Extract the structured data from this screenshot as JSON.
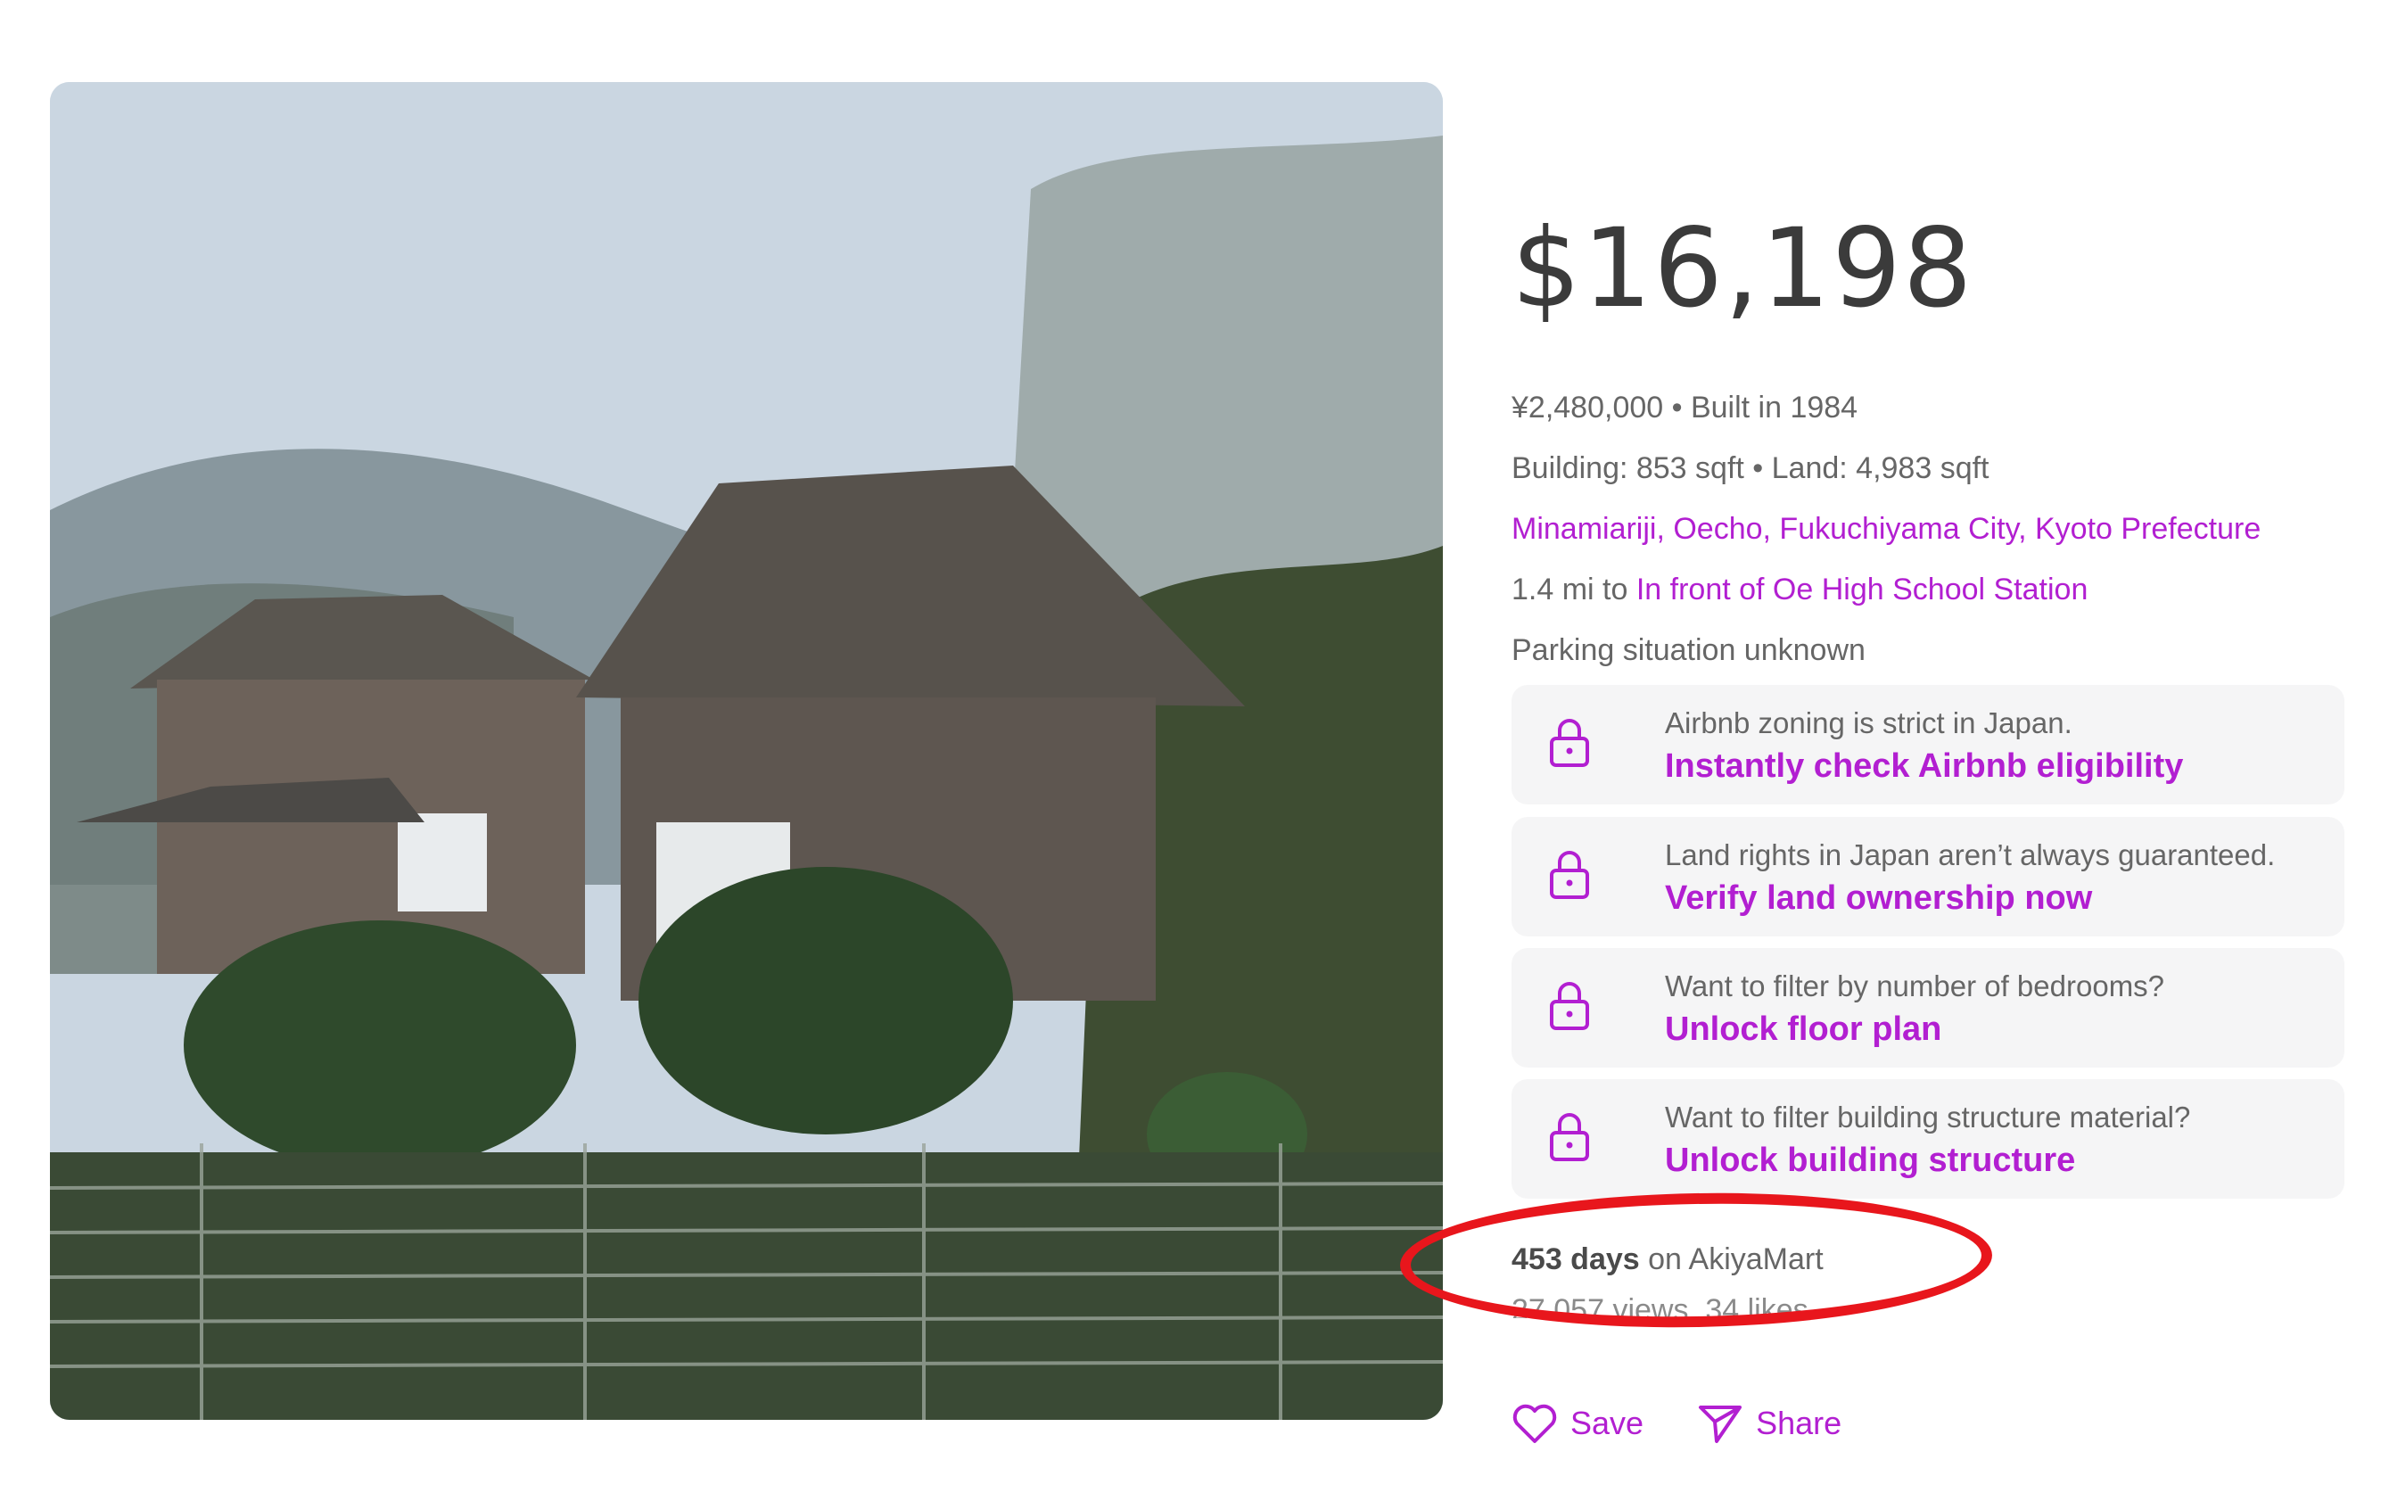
{
  "listing": {
    "price": "$16,198",
    "yen_and_year": "¥2,480,000 • Built in 1984",
    "sizes": "Building: 853 sqft • Land: 4,983 sqft",
    "address": "Minamiariji, Oecho, Fukuchiyama City, Kyoto Prefecture",
    "station_distance": "1.4 mi to",
    "station_name": "In front of Oe High School Station",
    "parking": "Parking situation unknown"
  },
  "cards": [
    {
      "message": "Airbnb zoning is strict in Japan.",
      "cta": "Instantly check Airbnb eligibility"
    },
    {
      "message": "Land rights in Japan aren’t always guaranteed.",
      "cta": "Verify land ownership now"
    },
    {
      "message": "Want to filter by number of bedrooms?",
      "cta": "Unlock floor plan"
    },
    {
      "message": "Want to filter building structure material?",
      "cta": "Unlock building structure"
    }
  ],
  "stats": {
    "days_count": "453 days",
    "days_suffix": "on AkiyaMart",
    "views_likes": "27,057 views, 34 likes"
  },
  "actions": {
    "save_label": "Save",
    "share_label": "Share"
  },
  "colors": {
    "accent": "#b21fd1",
    "annotation": "#e8161c",
    "text": "#666666",
    "card_bg": "#f5f5f6"
  },
  "icons": [
    "lock-icon",
    "heart-icon",
    "share-icon"
  ]
}
